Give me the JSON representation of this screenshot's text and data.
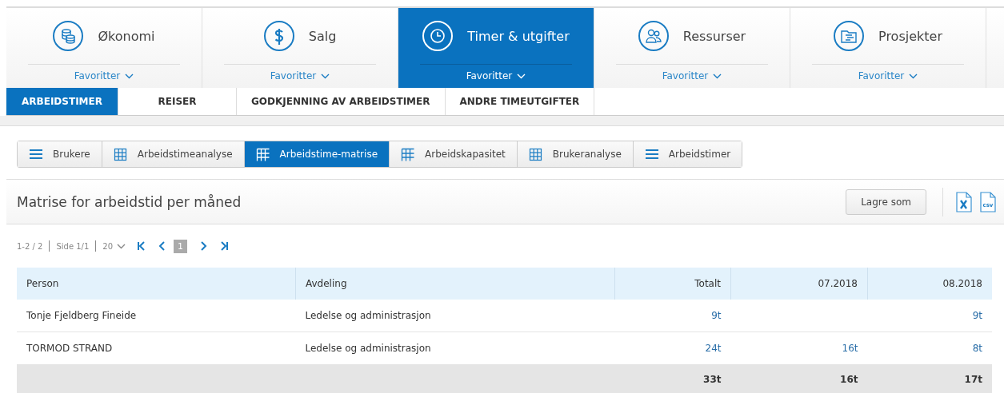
{
  "modules": [
    {
      "label": "Økonomi",
      "kind": "coins",
      "favorites": "Favoritter",
      "selected": false
    },
    {
      "label": "Salg",
      "kind": "dollar",
      "favorites": "Favoritter",
      "selected": false
    },
    {
      "label": "Timer & utgifter",
      "kind": "clock",
      "favorites": "Favoritter",
      "selected": true
    },
    {
      "label": "Ressurser",
      "kind": "people",
      "favorites": "Favoritter",
      "selected": false
    },
    {
      "label": "Prosjekter",
      "kind": "folder",
      "favorites": "Favoritter",
      "selected": false
    }
  ],
  "subtabs": [
    {
      "label": "ARBEIDSTIMER",
      "selected": true
    },
    {
      "label": "REISER",
      "selected": false
    },
    {
      "label": "GODKJENNING AV ARBEIDSTIMER",
      "selected": false
    },
    {
      "label": "ANDRE TIMEUTGIFTER",
      "selected": false
    }
  ],
  "views": [
    {
      "label": "Brukere",
      "kind": "list",
      "selected": false
    },
    {
      "label": "Arbeidstimeanalyse",
      "kind": "grid",
      "selected": false
    },
    {
      "label": "Arbeidstime-matrise",
      "kind": "matrix",
      "selected": true
    },
    {
      "label": "Arbeidskapasitet",
      "kind": "matrix",
      "selected": false
    },
    {
      "label": "Brukeranalyse",
      "kind": "grid",
      "selected": false
    },
    {
      "label": "Arbeidstimer",
      "kind": "list",
      "selected": false
    }
  ],
  "panel": {
    "title": "Matrise for arbeidstid per måned",
    "save_button": "Lagre som",
    "csv_label": "csv"
  },
  "pagination": {
    "range": "1-2 / 2",
    "page_info": "Side 1/1",
    "page_size": "20",
    "current_page": "1"
  },
  "table": {
    "columns": [
      "Person",
      "Avdeling",
      "Totalt",
      "07.2018",
      "08.2018"
    ],
    "rows": [
      [
        "Tonje Fjeldberg Fineide",
        "Ledelse og administrasjon",
        "9t",
        null,
        "9t"
      ],
      [
        "TORMOD STRAND",
        "Ledelse og administrasjon",
        "24t",
        "16t",
        "8t"
      ]
    ],
    "totals": [
      "33t",
      "16t",
      "17t"
    ]
  }
}
